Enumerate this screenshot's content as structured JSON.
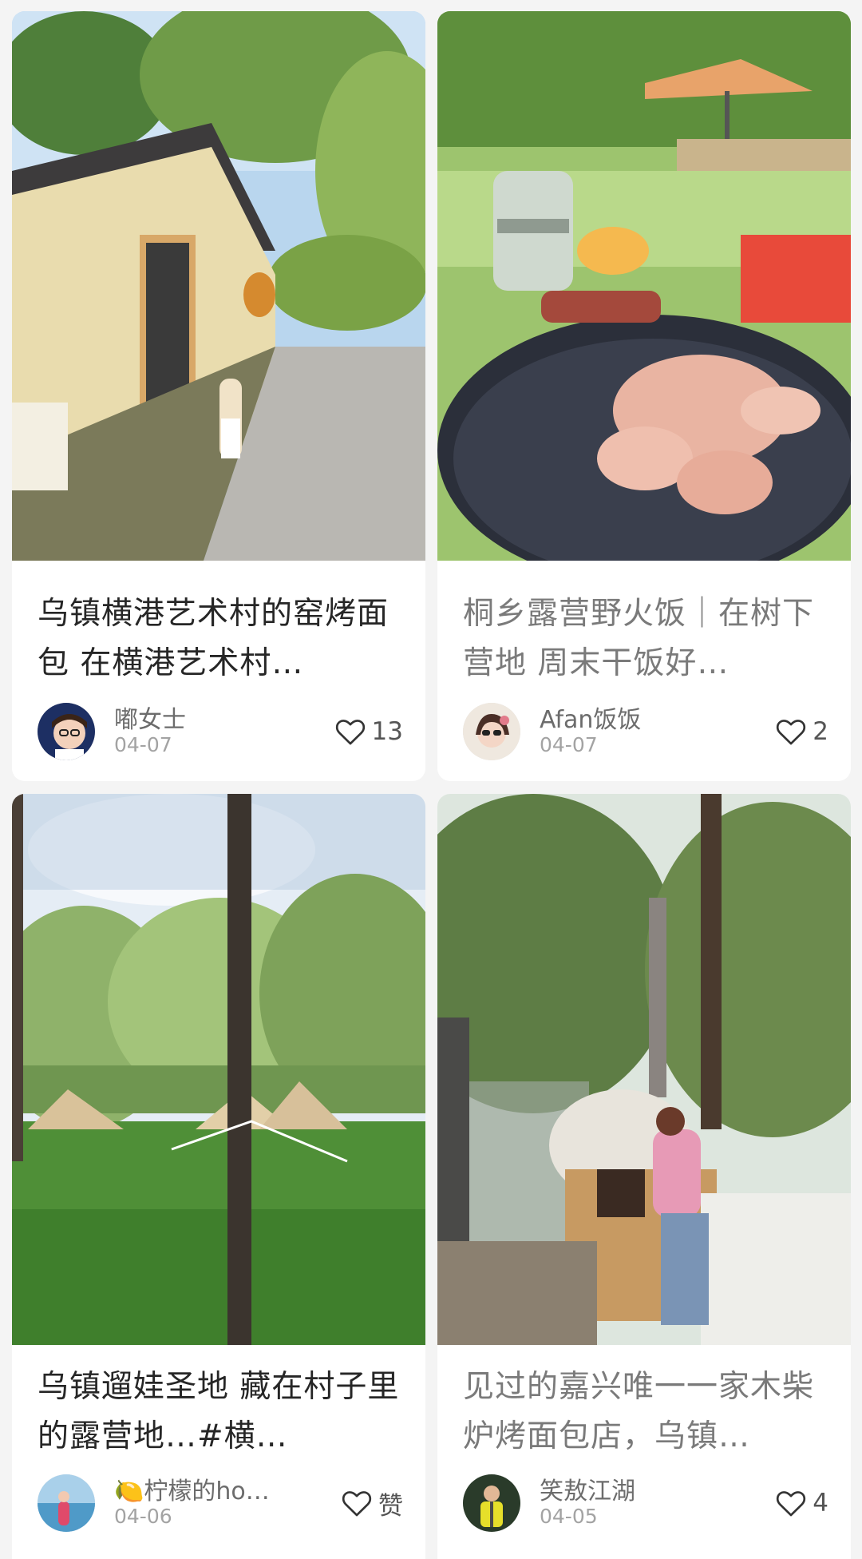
{
  "cards": [
    {
      "title": "乌镇横港艺术村的窑烤面包 在横港艺术村…",
      "author": "嘟女士",
      "date": "04-07",
      "likes": "13"
    },
    {
      "title": "桐乡露营野火饭｜在树下营地 周末干饭好…",
      "author": "Afan饭饭",
      "date": "04-07",
      "likes": "2"
    },
    {
      "title": "乌镇遛娃圣地 藏在村子里的露营地…#横…",
      "author": "🍋柠檬的ho…",
      "date": "04-06",
      "likes": "赞"
    },
    {
      "title": "见过的嘉兴唯一一家木柴炉烤面包店，乌镇…",
      "author": "笑敖江湖",
      "date": "04-05",
      "likes": "4"
    }
  ],
  "colors": {
    "background": "#f4f4f4",
    "card": "#ffffff",
    "title": "#262626",
    "title_read": "#7a7a7a",
    "meta": "#a3a3a3"
  },
  "icons": {
    "like": "heart-outline-icon"
  }
}
